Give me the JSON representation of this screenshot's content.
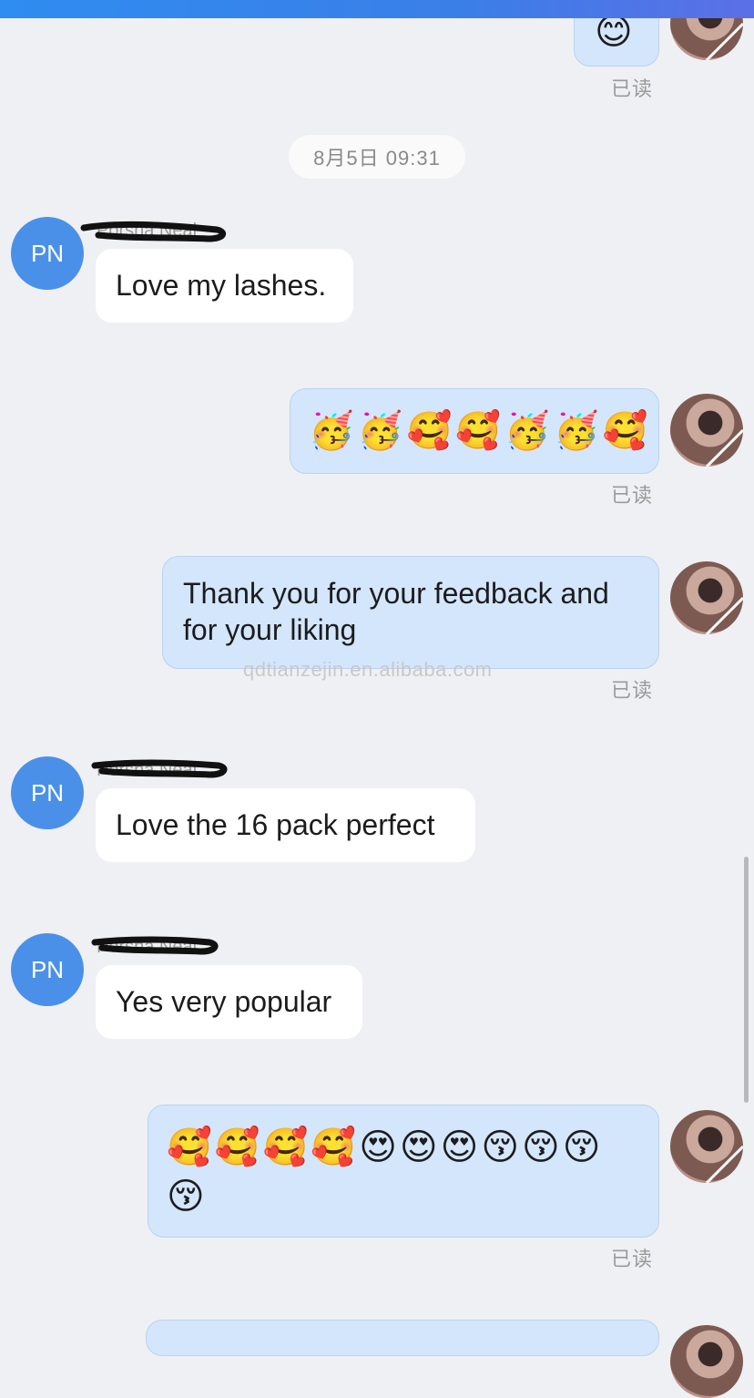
{
  "time_divider": "8月5日 09:31",
  "read_label": "已读",
  "watermark": "qdtianzejin.en.alibaba.com",
  "contact_initials": "PN",
  "messages": [
    {
      "type": "out_emoji_partial",
      "emoji": "😊"
    },
    {
      "type": "in",
      "sender": "Porsha Neal",
      "text": "Love my lashes."
    },
    {
      "type": "out_emoji",
      "emoji": "🥳🥳🥰🥰🥳🥳🥰"
    },
    {
      "type": "out",
      "text_line1": "Thank you for your feedback and",
      "text_line2": "for your liking"
    },
    {
      "type": "in",
      "sender": "Porsha Neal",
      "text": "Love the 16 pack perfect"
    },
    {
      "type": "in",
      "sender": "Porsha Neal",
      "text": "Yes very popular"
    },
    {
      "type": "out_emoji",
      "emoji_line1": "🥰🥰🥰🥰😍😍😍😚😚😚",
      "emoji_line2": "😚"
    }
  ],
  "colors": {
    "background": "#eff0f3",
    "outgoing_bubble": "#d3e6fb",
    "incoming_bubble": "#ffffff",
    "avatar": "#4a90e8",
    "topbar": "#3a7fe8"
  }
}
